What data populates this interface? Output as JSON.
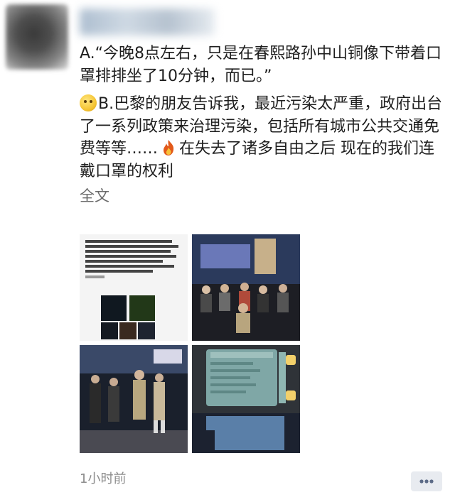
{
  "post": {
    "paragraph_a": "A.“今晚8点左右，只是在春熙路孙中山铜像下带着口罩排排坐了10分钟，而已。”",
    "paragraph_b_1": "B.巴黎的朋友告诉我，最近污染太严重，政府出台了一系列政策来治理污染，包括所有城市公共交通免费等等……",
    "paragraph_b_2": "在失去了诸多自由之后 现在的我们连戴口罩的权利",
    "more_label": "全文",
    "timestamp": "1小时前"
  },
  "icons": {
    "paragraph_b_emoji": "smiley-emoji-icon",
    "inline_emoji": "flame-emoji-icon",
    "comment_button": "comment-icon"
  },
  "colors": {
    "accent_link": "#6a6a6a",
    "timestamp": "#8c8c8c",
    "comment_button_bg": "#e8ebf0"
  }
}
